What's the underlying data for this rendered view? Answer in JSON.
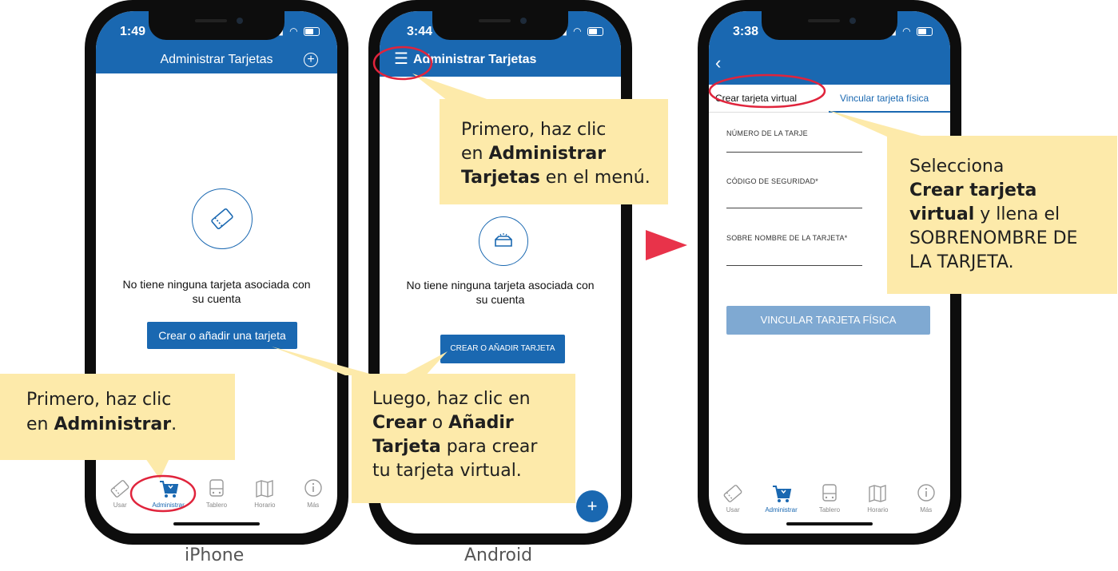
{
  "phone1": {
    "time": "1:49",
    "title": "Administrar Tarjetas",
    "empty_line1": "No tiene ninguna tarjeta asociada con",
    "empty_line2": "su cuenta",
    "button": "Crear o añadir una tarjeta",
    "tabs": [
      "Usar",
      "Administrar",
      "Tablero",
      "Horario",
      "Más"
    ],
    "caption": "iPhone"
  },
  "phone2": {
    "time": "3:44",
    "title": "Administrar Tarjetas",
    "empty_line1": "No tiene ninguna tarjeta asociada con",
    "empty_line2": "su cuenta",
    "button": "CREAR O AÑADIR TARJETA",
    "fab": "+",
    "caption": "Android"
  },
  "phone3": {
    "time": "3:38",
    "tab_create": "Crear tarjeta virtual",
    "tab_link": "Vincular tarjeta física",
    "field_number": "NÚMERO DE LA TARJE",
    "field_security": "CÓDIGO DE SEGURIDAD*",
    "field_nickname": "SOBRE NOMBRE DE LA TARJETA*",
    "button": "VINCULAR TARJETA FÍSICA",
    "tabs": [
      "Usar",
      "Administrar",
      "Tablero",
      "Horario",
      "Más"
    ]
  },
  "callouts": {
    "c1": {
      "line1": "Primero, haz clic",
      "pre": "en ",
      "bold": "Administrar",
      "post": "."
    },
    "c2": {
      "line1": "Primero, haz clic",
      "pre": "en ",
      "bold1": "Administrar",
      "bold2": "Tarjetas",
      "post": " en el menú."
    },
    "c3": {
      "line1": "Luego, haz clic en",
      "bold1": "Crear",
      "mid": " o ",
      "bold2": "Añadir",
      "bold3": "Tarjeta",
      "post": " para crear",
      "line4": "tu tarjeta virtual."
    },
    "c4": {
      "line1": "Selecciona",
      "bold1": "Crear tarjeta",
      "bold2": "virtual",
      "post": " y llena el",
      "line4": "SOBRENOMBRE DE",
      "line5": "LA TARJETA."
    }
  },
  "colors": {
    "brand": "#1a68b1",
    "callout": "#fdeaaa",
    "highlight": "#e0243c",
    "arrow": "#e8334a"
  }
}
